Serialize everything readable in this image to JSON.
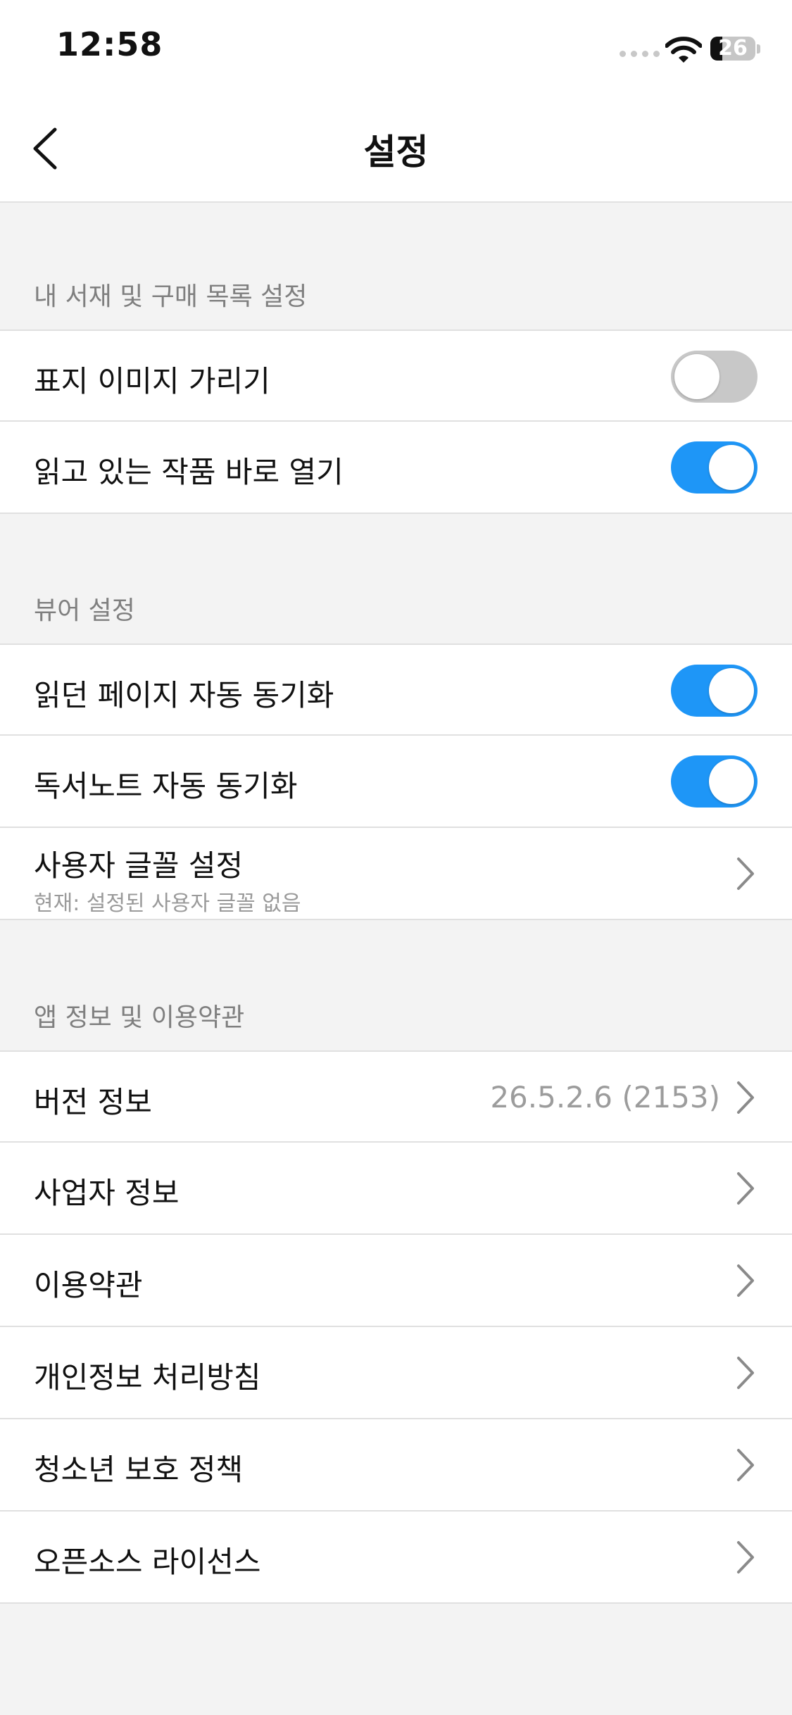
{
  "status_bar": {
    "time": "12:58",
    "battery_level": "26"
  },
  "nav": {
    "title": "설정"
  },
  "sections": [
    {
      "header": "내 서재 및 구매 목록 설정",
      "items": [
        {
          "label": "표지 이미지 가리기",
          "toggle": "off"
        },
        {
          "label": "읽고 있는 작품 바로 열기",
          "toggle": "on"
        }
      ]
    },
    {
      "header": "뷰어 설정",
      "items": [
        {
          "label": "읽던 페이지 자동 동기화",
          "toggle": "on"
        },
        {
          "label": "독서노트 자동 동기화",
          "toggle": "on"
        },
        {
          "label": "사용자 글꼴 설정",
          "sublabel": "현재: 설정된 사용자 글꼴 없음",
          "chevron": true
        }
      ]
    },
    {
      "header": "앱 정보 및 이용약관",
      "items": [
        {
          "label": "버전 정보",
          "value": "26.5.2.6 (2153)",
          "chevron": true
        },
        {
          "label": "사업자 정보",
          "chevron": true
        },
        {
          "label": "이용약관",
          "chevron": true
        },
        {
          "label": "개인정보 처리방침",
          "chevron": true
        },
        {
          "label": "청소년 보호 정책",
          "chevron": true
        },
        {
          "label": "오픈소스 라이선스",
          "chevron": true
        }
      ]
    }
  ],
  "colors": {
    "toggle_on": "#1e96f7",
    "toggle_off": "#c8c8c8",
    "background": "#f3f3f3"
  },
  "icons": {
    "back": "chevron-left-icon",
    "row_arrow": "chevron-right-icon",
    "wifi": "wifi-icon",
    "battery": "battery-icon",
    "signal": "signal-icon"
  }
}
